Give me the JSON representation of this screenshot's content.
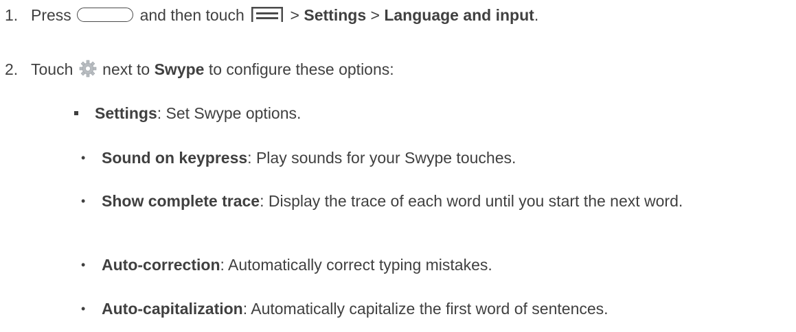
{
  "steps": [
    {
      "number": "1.",
      "press": "Press",
      "then_touch": "and then touch",
      "gt1": ">",
      "settings": "Settings",
      "gt2": ">",
      "lang_input": "Language and input",
      "period": ".",
      "home_key_icon": "home-key-icon",
      "menu_key_icon": "menu-key-icon"
    },
    {
      "number": "2.",
      "touch": "Touch",
      "next_to": "next to",
      "swype": "Swype",
      "configure": "to configure these options:",
      "gear_icon": "gear-icon"
    }
  ],
  "settings_item": {
    "label": "Settings",
    "desc": ": Set Swype options."
  },
  "options": [
    {
      "label": "Sound on keypress",
      "desc": ": Play sounds for your Swype touches."
    },
    {
      "label": "Show complete trace",
      "desc": ": Display the trace of each word until you start the next word."
    },
    {
      "label": "Auto-correction",
      "desc": ": Automatically correct typing mistakes."
    },
    {
      "label": "Auto-capitalization",
      "desc": ": Automatically capitalize the first word of sentences."
    }
  ],
  "bullet_glyph": "•"
}
